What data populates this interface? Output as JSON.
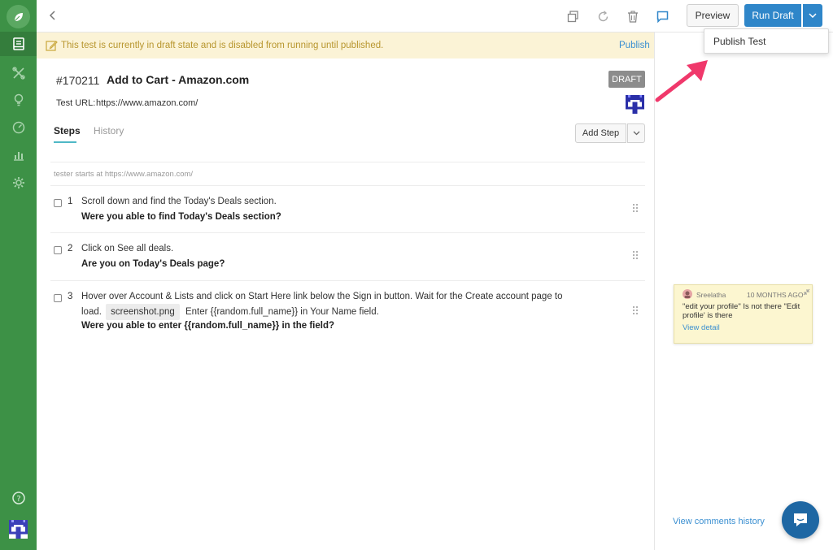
{
  "colors": {
    "sidebar": "#3d9146",
    "accent": "#2f86c9",
    "banner_bg": "#fbf3d6",
    "banner_text": "#b8962e",
    "link": "#3a8fd1",
    "comment_bg": "#fcf6d0",
    "arrow": "#f0386b"
  },
  "sidebar": {
    "icons": [
      "leaf-icon",
      "test-cases-icon",
      "tools-icon",
      "lightbulb-icon",
      "dashboard-icon",
      "chart-icon",
      "settings-icon",
      "help-icon",
      "avatar"
    ]
  },
  "toolbar": {
    "icons": [
      "back-icon",
      "duplicate-icon",
      "refresh-icon",
      "trash-icon",
      "comment-icon"
    ],
    "preview_label": "Preview",
    "run_label": "Run Draft",
    "dropdown_item": "Publish Test"
  },
  "banner": {
    "text": "This test is currently in draft state and is disabled from running until published.",
    "link": "Publish"
  },
  "test": {
    "id": "#170211",
    "title": "Add to Cart - Amazon.com",
    "status": "DRAFT",
    "url_label": "Test URL:",
    "url": "https://www.amazon.com/"
  },
  "tabs": {
    "steps": "Steps",
    "history": "History"
  },
  "add_step_label": "Add Step",
  "starts_text": "tester starts at https://www.amazon.com/",
  "steps": [
    {
      "num": "1",
      "text": "Scroll down and find the Today's Deals section.",
      "question": "Were you able to find Today's Deals section?"
    },
    {
      "num": "2",
      "text": "Click on See all deals.",
      "question": "Are you on Today's Deals page?"
    },
    {
      "num": "3",
      "text_a": "Hover over Account & Lists and click on Start Here link below the Sign in button. Wait for the Create account page to",
      "text_b": "load.",
      "attachment": "screenshot.png",
      "text_c": "Enter {{random.full_name}} in Your Name field.",
      "question": "Were you able to enter {{random.full_name}} in the field?"
    }
  ],
  "comment": {
    "author": "Sreelatha",
    "time": "10 MONTHS AGO",
    "text": "\"edit your profile\" Is not there \"Edit profile' is there",
    "link": "View detail"
  },
  "comments_history": "View comments history"
}
